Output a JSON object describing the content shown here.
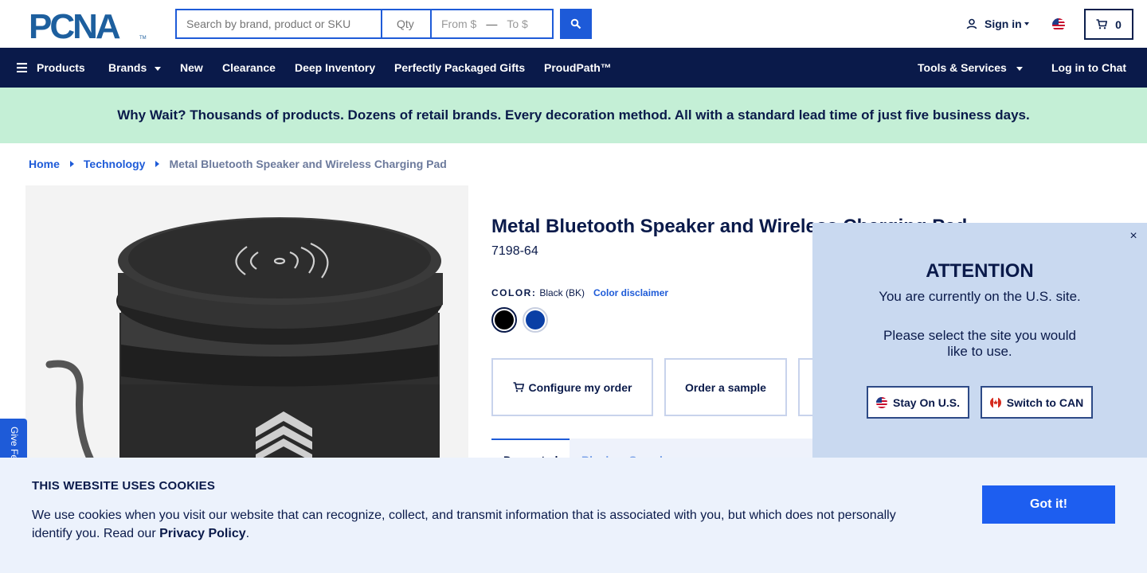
{
  "header": {
    "logo_text": "PCNA",
    "search_placeholder": "Search by brand, product or SKU",
    "qty_placeholder": "Qty",
    "price_from_placeholder": "From $",
    "price_to_placeholder": "To $",
    "price_dash": "—",
    "signin_label": "Sign in",
    "cart_count": "0"
  },
  "nav": {
    "products": "Products",
    "brands": "Brands",
    "new": "New",
    "clearance": "Clearance",
    "deep_inventory": "Deep Inventory",
    "gifts": "Perfectly Packaged Gifts",
    "proudpath": "ProudPath™",
    "tools": "Tools & Services",
    "chat": "Log in to Chat"
  },
  "promo": {
    "text": "Why Wait? Thousands of products. Dozens of retail brands. Every decoration method. All with a standard lead time of just five business days."
  },
  "breadcrumb": {
    "home": "Home",
    "category": "Technology",
    "current": "Metal Bluetooth Speaker and Wireless Charging Pad"
  },
  "product": {
    "title": "Metal Bluetooth Speaker and Wireless Charging Pad",
    "sku": "7198-64",
    "color_label": "COLOR:",
    "color_value": "Black (BK)",
    "color_disclaimer": "Color disclaimer",
    "swatches": [
      {
        "name": "Black",
        "color": "#000000"
      },
      {
        "name": "Blue",
        "color": "#0a3fa5"
      }
    ],
    "configure_label": "Configure my order",
    "sample_label": "Order a sample",
    "tab_decorated": "Decorated",
    "tab_blank": "Blank or Sample"
  },
  "modal": {
    "title": "ATTENTION",
    "line1": "You are currently on the U.S. site.",
    "line2": "Please select the site you would like to use.",
    "stay_label": "Stay On U.S.",
    "switch_label": "Switch to CAN",
    "close_glyph": "×"
  },
  "feedback": {
    "label": "Give Feedback"
  },
  "cookie": {
    "title": "THIS WEBSITE USES COOKIES",
    "text": "We use cookies when you visit our website that can recognize, collect, and transmit information that is associated with you, but which does not personally identify you. Read our",
    "link": "Privacy Policy",
    "period": ".",
    "button": "Got it!"
  },
  "colors": {
    "navy": "#0a1a4a",
    "blue": "#1e5bd8",
    "promo_green": "#c4efd6",
    "modal_bg": "#c9d9f0",
    "cookie_bg": "#ecf2fc"
  }
}
